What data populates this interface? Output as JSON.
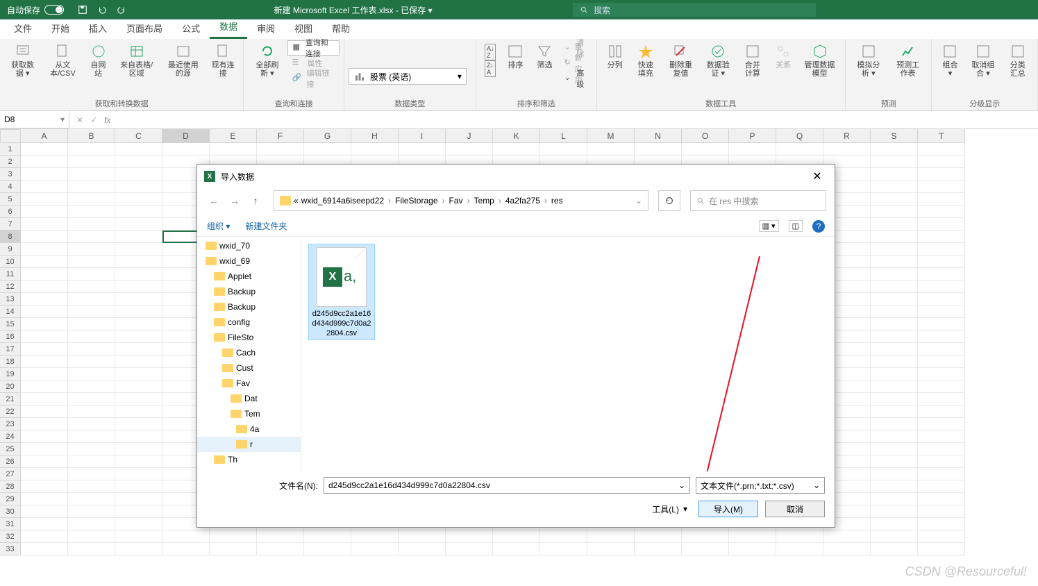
{
  "titlebar": {
    "autosave": "自动保存",
    "title": "新建 Microsoft Excel 工作表.xlsx - 已保存 ▾",
    "search_placeholder": "搜索"
  },
  "tabs": [
    "文件",
    "开始",
    "插入",
    "页面布局",
    "公式",
    "数据",
    "审阅",
    "视图",
    "帮助"
  ],
  "active_tab": "数据",
  "ribbon": {
    "groups": [
      {
        "label": "获取和转换数据",
        "items": [
          "获取数据 ▾",
          "从文本/CSV",
          "自网站",
          "来自表格/区域",
          "最近使用的源",
          "现有连接"
        ]
      },
      {
        "label": "查询和连接",
        "items": [
          "全部刷新 ▾",
          "查询和连接",
          "属性",
          "编辑链接"
        ]
      },
      {
        "label": "数据类型",
        "combo": "股票 (英语)"
      },
      {
        "label": "排序和筛选",
        "sort_az": "A→Z",
        "sort_za": "Z→A",
        "sort": "排序",
        "filter": "筛选",
        "clear": "清除",
        "reapply": "重新应用",
        "advanced": "高级"
      },
      {
        "label": "数据工具",
        "items": [
          "分列",
          "快速填充",
          "删除重复值",
          "数据验证 ▾",
          "合并计算",
          "关系",
          "管理数据模型"
        ]
      },
      {
        "label": "预测",
        "items": [
          "模拟分析 ▾",
          "预测工作表"
        ]
      },
      {
        "label": "分级显示",
        "items": [
          "组合 ▾",
          "取消组合 ▾",
          "分类汇总"
        ]
      }
    ]
  },
  "namebox": "D8",
  "columns": [
    "A",
    "B",
    "C",
    "D",
    "E",
    "F",
    "G",
    "H",
    "I",
    "J",
    "K",
    "L",
    "M",
    "N",
    "O",
    "P",
    "Q",
    "R",
    "S",
    "T"
  ],
  "row_count": 33,
  "active_col": "D",
  "active_row": 8,
  "dialog": {
    "title": "导入数据",
    "breadcrumb": [
      "«",
      "wxid_6914a6iseepd22",
      "FileStorage",
      "Fav",
      "Temp",
      "4a2fa275",
      "res"
    ],
    "search_placeholder": "在 res 中搜索",
    "toolbar": {
      "organize": "组织 ▾",
      "newfolder": "新建文件夹"
    },
    "tree": [
      "wxid_70",
      "wxid_69",
      "Applet",
      "Backup",
      "Backup",
      "config",
      "FileSto",
      "Cach",
      "Cust",
      "Fav",
      "Dat",
      "Tem",
      "4a",
      "r",
      "Th"
    ],
    "tree_depths": [
      0,
      0,
      1,
      1,
      1,
      1,
      1,
      2,
      2,
      2,
      3,
      3,
      4,
      4,
      1
    ],
    "tree_sel": 13,
    "file": {
      "name": "d245d9cc2a1e16d434d999c7d0a22804.csv"
    },
    "footer": {
      "filename_label": "文件名(N):",
      "filename_value": "d245d9cc2a1e16d434d999c7d0a22804.csv",
      "filter": "文本文件(*.prn;*.txt;*.csv)",
      "tools": "工具(L)",
      "import": "导入(M)",
      "cancel": "取消"
    }
  },
  "watermark": "CSDN @Resourceful!"
}
